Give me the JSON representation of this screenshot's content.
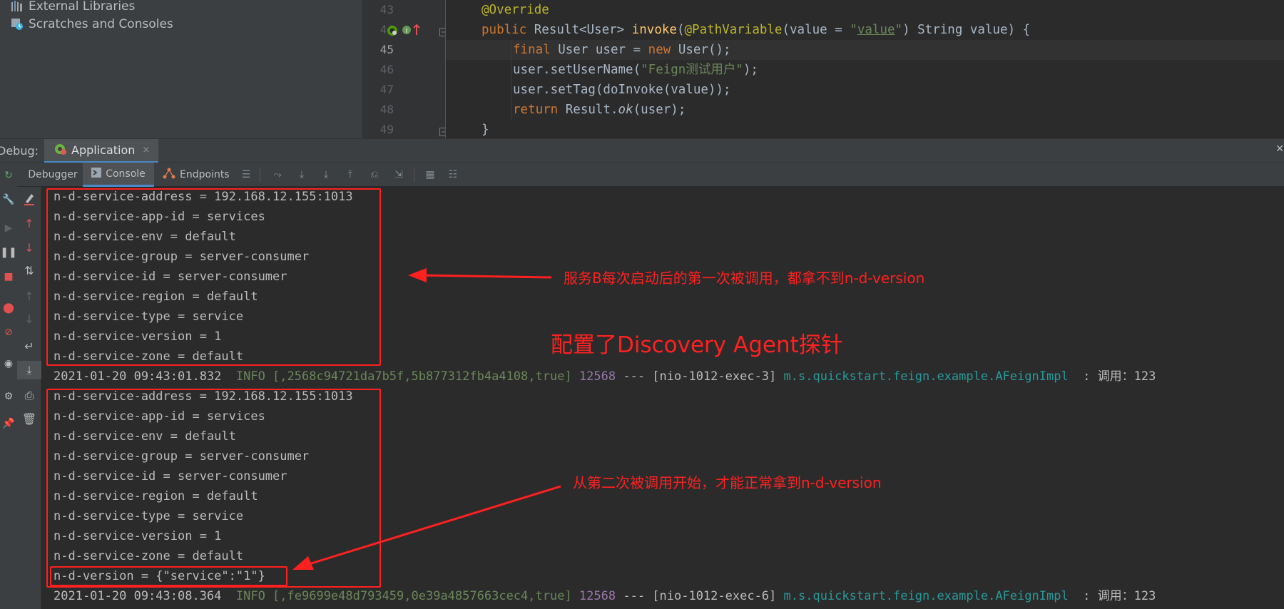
{
  "project": {
    "items": [
      {
        "label": "External Libraries",
        "icon": "libraries-icon"
      },
      {
        "label": "Scratches and Consoles",
        "icon": "scratches-icon"
      }
    ]
  },
  "editor": {
    "line_numbers": [
      "43",
      "44",
      "45",
      "46",
      "47",
      "48",
      "49"
    ],
    "current_line": "45",
    "code": {
      "l43_annotation": "@Override",
      "l44_public": "public ",
      "l44_type": "Result<User> ",
      "l44_method": "invoke",
      "l44_open": "(",
      "l44_pathvar": "@PathVariable",
      "l44_args_a": "(value = ",
      "l44_q1": "\"",
      "l44_value": "value",
      "l44_q2": "\"",
      "l44_args_b": ") String value) {",
      "l45_final": "final ",
      "l45_mid": "User user = ",
      "l45_new": "new ",
      "l45_end": "User();",
      "l46_a": "user.setUserName(",
      "l46_str": "\"Feign测试用户\"",
      "l46_b": ");",
      "l47": "user.setTag(doInvoke(value));",
      "l48_return": "return ",
      "l48_a": "Result.",
      "l48_ok": "ok",
      "l48_b": "(user);",
      "l49": "}"
    }
  },
  "debug": {
    "label": "Debug:",
    "app_tab": "Application",
    "close_glyph": "×"
  },
  "toolbar": {
    "tabs": [
      {
        "label": "Debugger"
      },
      {
        "label": "Console"
      },
      {
        "label": "Endpoints"
      }
    ]
  },
  "console": {
    "block1": [
      "n-d-service-address = 192.168.12.155:1013",
      "n-d-service-app-id = services",
      "n-d-service-env = default",
      "n-d-service-group = server-consumer",
      "n-d-service-id = server-consumer",
      "n-d-service-region = default",
      "n-d-service-type = service",
      "n-d-service-version = 1",
      "n-d-service-zone = default"
    ],
    "log1": {
      "time": "2021-01-20 09:43:01.832  ",
      "level": "INFO [,2568c94721da7b5f,5b877312fb4a4108,true] ",
      "pid": "12568",
      "thread": " --- [nio-1012-exec-3] ",
      "logger": "m.s.quickstart.feign.example.AFeignImpl",
      "msg": "  : 调用：123"
    },
    "block2": [
      "n-d-service-address = 192.168.12.155:1013",
      "n-d-service-app-id = services",
      "n-d-service-env = default",
      "n-d-service-group = server-consumer",
      "n-d-service-id = server-consumer",
      "n-d-service-region = default",
      "n-d-service-type = service",
      "n-d-service-version = 1",
      "n-d-service-zone = default",
      "n-d-version = {\"service\":\"1\"}"
    ],
    "log2": {
      "time": "2021-01-20 09:43:08.364  ",
      "level": "INFO [,fe9699e48d793459,0e39a4857663cec4,true] ",
      "pid": "12568",
      "thread": " --- [nio-1012-exec-6] ",
      "logger": "m.s.quickstart.feign.example.AFeignImpl",
      "msg": "  : 调用：123"
    }
  },
  "annotations": {
    "note1": "服务B每次启动后的第一次被调用，都拿不到n-d-version",
    "title": "配置了Discovery Agent探针",
    "note2": "从第二次被调用开始，才能正常拿到n-d-version",
    "color": "#ff2020"
  }
}
